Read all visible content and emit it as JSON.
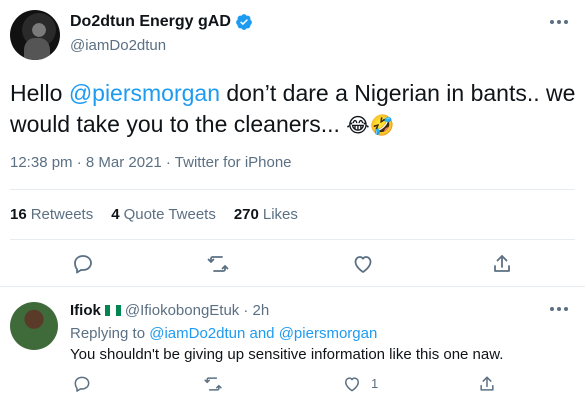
{
  "tweet": {
    "display_name": "Do2dtun Energy gAD",
    "handle": "@iamDo2dtun",
    "text_before": "Hello ",
    "mention": "@piersmorgan",
    "text_after": " don’t dare a Nigerian in bants.. we would take you to the cleaners...",
    "emojis": "😂🤣",
    "timestamp": "12:38 pm · 8 Mar 2021 · Twitter for iPhone",
    "retweets_count": "16",
    "retweets_label": "Retweets",
    "quote_count": "4",
    "quote_label": "Quote Tweets",
    "likes_count": "270",
    "likes_label": "Likes"
  },
  "reply": {
    "display_name": "Ifiok",
    "handle": "@IfiokobongEtuk",
    "time": "· 2h",
    "replying_prefix": "Replying to ",
    "replying_to_1": "@iamDo2dtun",
    "replying_and": " and ",
    "replying_to_2": "@piersmorgan",
    "text": "You shouldn't be giving up sensitive information like this one naw.",
    "like_count": "1"
  },
  "colors": {
    "accent": "#1d9bf0",
    "secondary_text": "#5b7083",
    "divider": "#e6ecf0",
    "flag_green": "#008751"
  },
  "icons": [
    "verified-badge-icon",
    "more-options-icon",
    "reply-icon",
    "retweet-icon",
    "like-icon",
    "share-icon",
    "nigeria-flag-icon"
  ]
}
